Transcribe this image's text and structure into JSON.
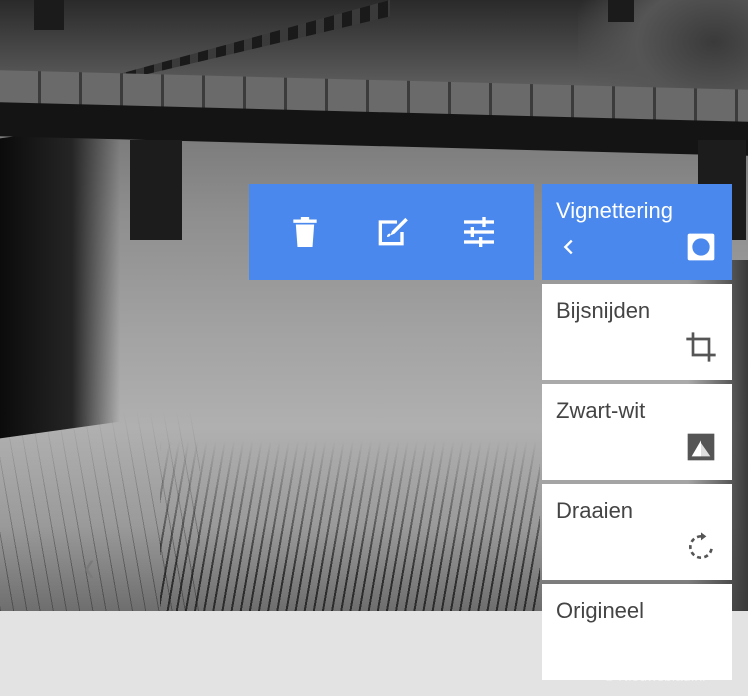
{
  "toolbar": {
    "buttons": [
      {
        "icon": "trash-icon",
        "label": "Verwijderen"
      },
      {
        "icon": "edit-image-icon",
        "label": "Bewerken"
      },
      {
        "icon": "sliders-icon",
        "label": "Aanpassen"
      }
    ]
  },
  "menu": {
    "items": [
      {
        "label": "Vignettering",
        "icon": "vignette-icon",
        "active": true
      },
      {
        "label": "Bijsnijden",
        "icon": "crop-icon",
        "active": false
      },
      {
        "label": "Zwart-wit",
        "icon": "black-white-icon",
        "active": false
      },
      {
        "label": "Draaien",
        "icon": "rotate-icon",
        "active": false
      },
      {
        "label": "Origineel",
        "icon": "",
        "active": false
      }
    ],
    "back_icon": "chevron-left-icon"
  },
  "colors": {
    "accent": "#4a88ee",
    "menu_background": "#ffffff",
    "label_text": "#444444",
    "footer_background": "#e3e3e3"
  },
  "watermark": "© Nieuwsblad.nl"
}
